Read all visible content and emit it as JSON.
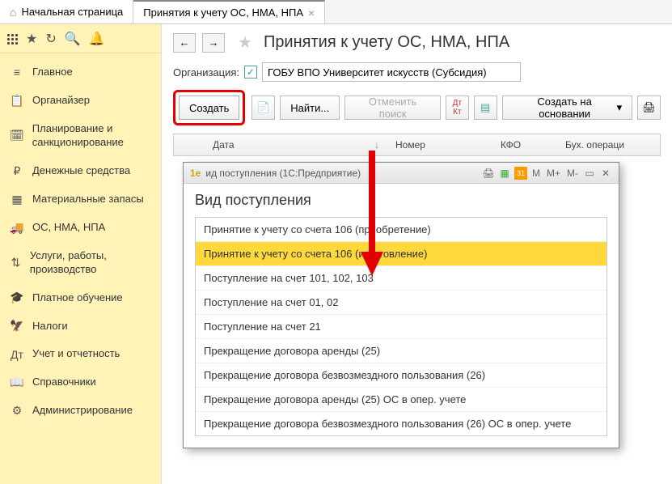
{
  "tabs": [
    {
      "label": "Начальная страница"
    },
    {
      "label": "Принятия к учету ОС, НМА, НПА"
    }
  ],
  "sidebar": {
    "items": [
      {
        "icon": "≡",
        "label": "Главное"
      },
      {
        "icon": "📋",
        "label": "Органайзер"
      },
      {
        "icon": "🗓",
        "label": "Планирование и санкционирование"
      },
      {
        "icon": "₽",
        "label": "Денежные средства"
      },
      {
        "icon": "▦",
        "label": "Материальные запасы"
      },
      {
        "icon": "🚚",
        "label": "ОС, НМА, НПА"
      },
      {
        "icon": "⇅",
        "label": "Услуги, работы, производство"
      },
      {
        "icon": "🎓",
        "label": "Платное обучение"
      },
      {
        "icon": "🦅",
        "label": "Налоги"
      },
      {
        "icon": "Дт",
        "label": "Учет и отчетность"
      },
      {
        "icon": "📖",
        "label": "Справочники"
      },
      {
        "icon": "⚙",
        "label": "Администрирование"
      }
    ]
  },
  "page": {
    "title": "Принятия к учету ОС, НМА, НПА",
    "org_label": "Организация:",
    "org_value": "ГОБУ ВПО Университет искусств (Субсидия)"
  },
  "toolbar": {
    "create": "Создать",
    "find": "Найти...",
    "cancel_search": "Отменить поиск",
    "create_based": "Создать на основании"
  },
  "table": {
    "date": "Дата",
    "number": "Номер",
    "kfo": "КФО",
    "operation": "Бух. операци"
  },
  "modal": {
    "window_title": "ид поступления (1С:Предприятие)",
    "heading": "Вид поступления",
    "tools": {
      "m": "M",
      "m_plus": "M+",
      "m_minus": "M-"
    },
    "items": [
      "Принятие к учету со счета 106 (приобретение)",
      "Принятие к учету со счета 106 (изготовление)",
      "Поступление на счет 101, 102, 103",
      "Поступление на счет 01, 02",
      "Поступление на счет 21",
      "Прекращение договора аренды (25)",
      "Прекращение договора безвозмездного пользования (26)",
      "Прекращение договора аренды (25) ОС в опер. учете",
      "Прекращение договора безвозмездного пользования (26) ОС в опер. учете"
    ],
    "selected_index": 1
  }
}
